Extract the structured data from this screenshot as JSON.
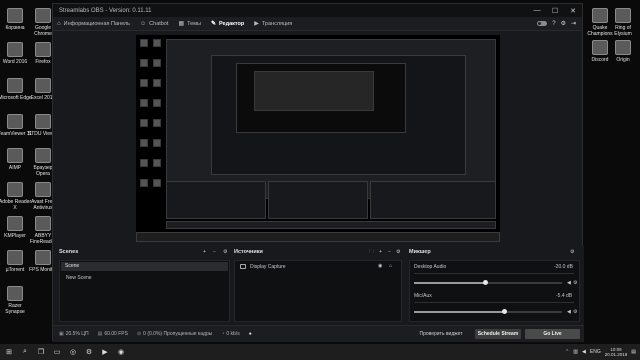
{
  "desktop_left": [
    {
      "label": "Корзина",
      "icon": "recycle-bin-icon"
    },
    {
      "label": "Google Chrome",
      "icon": "chrome-icon"
    },
    {
      "label": "Word 2016",
      "icon": "word-icon"
    },
    {
      "label": "Firefox",
      "icon": "firefox-icon"
    },
    {
      "label": "Microsoft Edge",
      "icon": "edge-icon"
    },
    {
      "label": "Excel 2016",
      "icon": "excel-icon"
    },
    {
      "label": "TeamViewer 11",
      "icon": "teamviewer-icon"
    },
    {
      "label": "STDU Viewer",
      "icon": "stdu-icon"
    },
    {
      "label": "AIMP",
      "icon": "aimp-icon"
    },
    {
      "label": "Браузер Opera",
      "icon": "opera-icon"
    },
    {
      "label": "Adobe Reader X",
      "icon": "adobe-reader-icon"
    },
    {
      "label": "Avast Free Antivirus",
      "icon": "avast-icon"
    },
    {
      "label": "KMPlayer",
      "icon": "kmplayer-icon"
    },
    {
      "label": "ABBYY FineReader",
      "icon": "abbyy-icon"
    },
    {
      "label": "µTorrent",
      "icon": "utorrent-icon"
    },
    {
      "label": "FPS Monitor",
      "icon": "fps-monitor-icon"
    },
    {
      "label": "Razer Synapse",
      "icon": "razer-icon"
    }
  ],
  "desktop_right": [
    {
      "label": "Quake Champions",
      "icon": "quake-icon"
    },
    {
      "label": "Ring of Elysium",
      "icon": "ring-of-elysium-icon"
    },
    {
      "label": "Discord",
      "icon": "discord-icon"
    },
    {
      "label": "Origin",
      "icon": "origin-icon"
    }
  ],
  "window": {
    "title": "Streamlabs OBS - Version: 0.11.11",
    "controls": [
      "—",
      "☐",
      "✕"
    ]
  },
  "nav": {
    "tabs": [
      {
        "label": "Информационная Панель",
        "icon": "dashboard-icon",
        "active": false
      },
      {
        "label": "Chatbot",
        "icon": "chatbot-icon",
        "active": false
      },
      {
        "label": "Темы",
        "icon": "themes-icon",
        "active": false
      },
      {
        "label": "Редактор",
        "icon": "editor-icon",
        "active": true
      },
      {
        "label": "Трансляция",
        "icon": "live-icon",
        "active": false
      }
    ]
  },
  "scenes": {
    "title": "Scenes",
    "selected": "Scene",
    "items": [
      "New Scene"
    ],
    "actions": [
      "+",
      "−",
      "⚙"
    ]
  },
  "sources": {
    "title": "Источники",
    "items": [
      "Display Capture"
    ],
    "actions": [
      "🗀",
      "+",
      "−",
      "⚙"
    ]
  },
  "mixer": {
    "title": "Микшер",
    "channels": [
      {
        "name": "Desktop Audio",
        "db": "-20.0 dB",
        "level": 0.48
      },
      {
        "name": "Mic/Aux",
        "db": "-5.4 dB",
        "level": 0.61
      }
    ]
  },
  "status": {
    "cpu": "20.5% ЦП",
    "fps": "60.00 FPS",
    "dropped": "0 (0.0%) Пропущенные кадры",
    "bitrate": "0 kb/s",
    "test_widget": "Проверить виджет",
    "schedule": "Schedule Stream",
    "go_live": "Go Live"
  },
  "taskbar": {
    "lang": "ENG",
    "time": "10:08",
    "date": "20.01.2019"
  }
}
